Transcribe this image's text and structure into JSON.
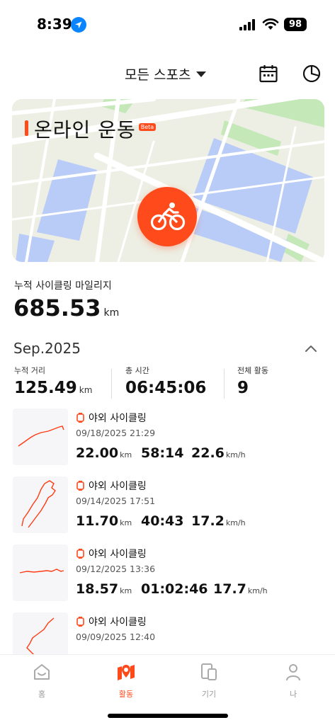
{
  "status_bar": {
    "time": "8:39",
    "battery": "98",
    "icons": [
      "location-arrow-icon",
      "cellular-signal-icon",
      "wifi-icon",
      "battery-icon"
    ]
  },
  "header": {
    "sport_filter": "모든 스포츠",
    "icons": [
      "calendar-icon",
      "pie-chart-icon"
    ]
  },
  "online_workout": {
    "title": "온라인  운동",
    "badge": "Beta",
    "start_icon": "bicycle-icon"
  },
  "mileage": {
    "label": "누적 사이클링 마일리지",
    "value": "685.53",
    "unit": "km"
  },
  "month": {
    "label": "Sep.2025",
    "stats": [
      {
        "label": "누적 거리",
        "value": "125.49",
        "unit": "km"
      },
      {
        "label": "총 시간",
        "value": "06:45:06",
        "unit": ""
      },
      {
        "label": "전체 활동",
        "value": "9",
        "unit": ""
      }
    ]
  },
  "activities": [
    {
      "type": "야외 사이클링",
      "date": "09/18/2025 21:29",
      "distance": "22.00",
      "distance_unit": "km",
      "duration": "58:14",
      "speed": "22.6",
      "speed_unit": "km/h"
    },
    {
      "type": "야외 사이클링",
      "date": "09/14/2025 17:51",
      "distance": "11.70",
      "distance_unit": "km",
      "duration": "40:43",
      "speed": "17.2",
      "speed_unit": "km/h"
    },
    {
      "type": "야외 사이클링",
      "date": "09/12/2025 13:36",
      "distance": "18.57",
      "distance_unit": "km",
      "duration": "01:02:46",
      "speed": "17.7",
      "speed_unit": "km/h"
    },
    {
      "type": "야외 사이클링",
      "date": "09/09/2025 12:40",
      "distance": "",
      "distance_unit": "",
      "duration": "",
      "speed": "",
      "speed_unit": ""
    }
  ],
  "bottom_nav": [
    {
      "label": "홈",
      "icon": "home-icon",
      "active": false
    },
    {
      "label": "활동",
      "icon": "activity-map-icon",
      "active": true
    },
    {
      "label": "기기",
      "icon": "devices-icon",
      "active": false
    },
    {
      "label": "나",
      "icon": "person-icon",
      "active": false
    }
  ],
  "colors": {
    "accent": "#ff4a1c",
    "map_water": "#b3c8f7",
    "map_park": "#bfe6b2",
    "map_land": "#eceee2"
  }
}
